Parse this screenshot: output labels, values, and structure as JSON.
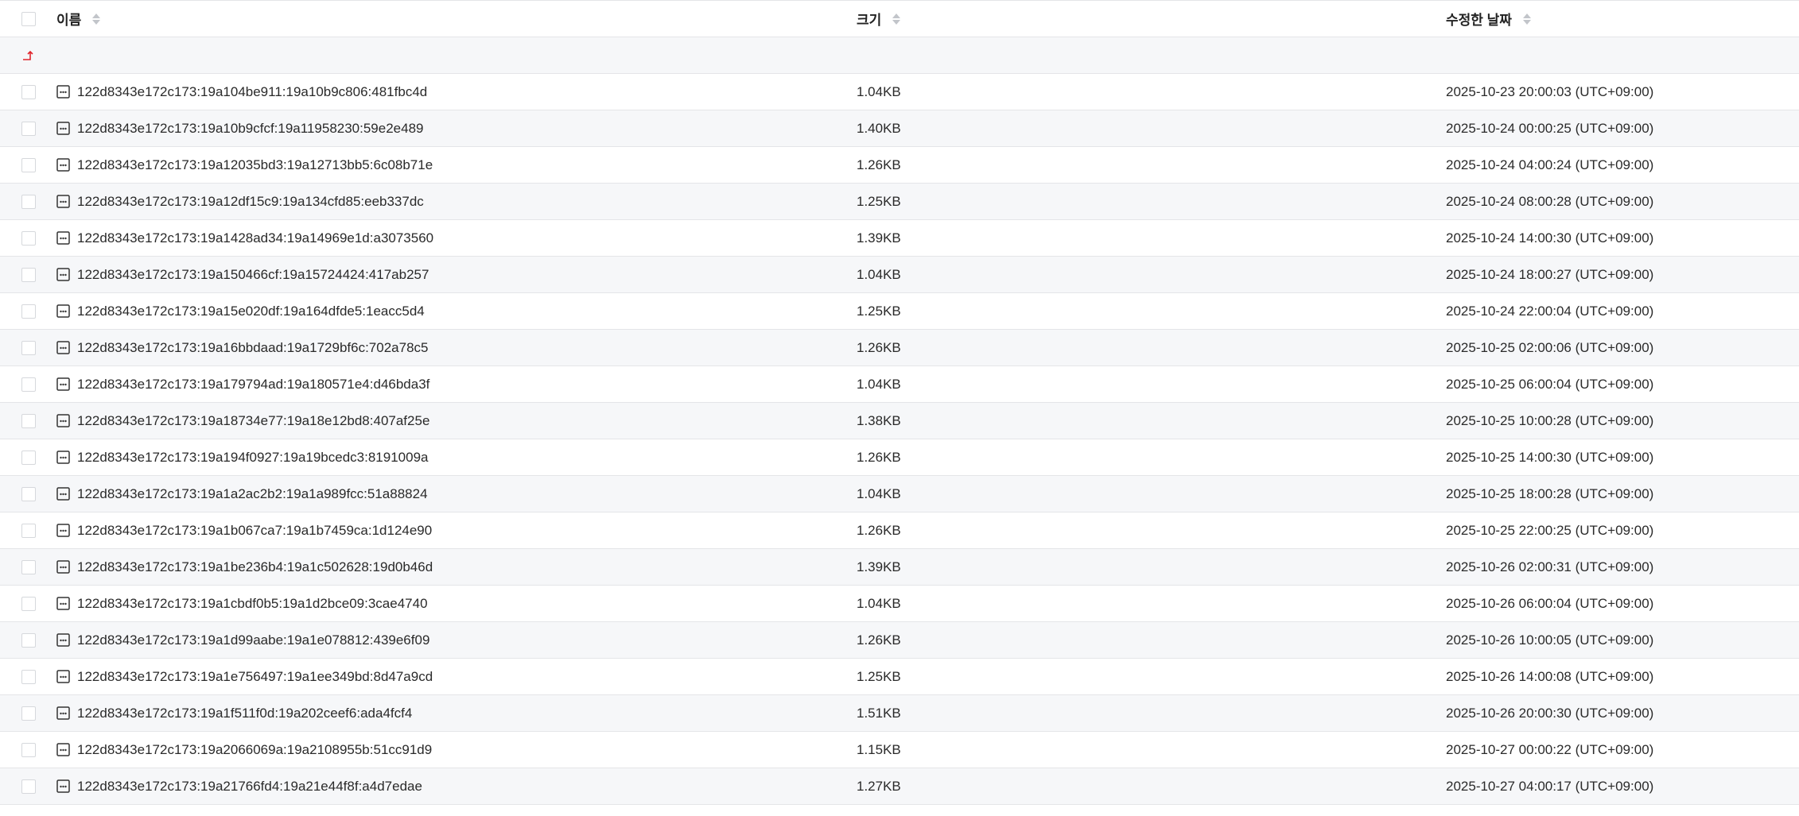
{
  "header": {
    "name": "이름",
    "size": "크기",
    "modified": "수정한 날짜"
  },
  "parent_row": {
    "icon": "up-arrow-icon",
    "accent": "#e0242b"
  },
  "files": [
    {
      "name": "122d8343e172c173:19a104be911:19a10b9c806:481fbc4d",
      "size": "1.04KB",
      "date": "2025-10-23 20:00:03 (UTC+09:00)"
    },
    {
      "name": "122d8343e172c173:19a10b9cfcf:19a11958230:59e2e489",
      "size": "1.40KB",
      "date": "2025-10-24 00:00:25 (UTC+09:00)"
    },
    {
      "name": "122d8343e172c173:19a12035bd3:19a12713bb5:6c08b71e",
      "size": "1.26KB",
      "date": "2025-10-24 04:00:24 (UTC+09:00)"
    },
    {
      "name": "122d8343e172c173:19a12df15c9:19a134cfd85:eeb337dc",
      "size": "1.25KB",
      "date": "2025-10-24 08:00:28 (UTC+09:00)"
    },
    {
      "name": "122d8343e172c173:19a1428ad34:19a14969e1d:a3073560",
      "size": "1.39KB",
      "date": "2025-10-24 14:00:30 (UTC+09:00)"
    },
    {
      "name": "122d8343e172c173:19a150466cf:19a15724424:417ab257",
      "size": "1.04KB",
      "date": "2025-10-24 18:00:27 (UTC+09:00)"
    },
    {
      "name": "122d8343e172c173:19a15e020df:19a164dfde5:1eacc5d4",
      "size": "1.25KB",
      "date": "2025-10-24 22:00:04 (UTC+09:00)"
    },
    {
      "name": "122d8343e172c173:19a16bbdaad:19a1729bf6c:702a78c5",
      "size": "1.26KB",
      "date": "2025-10-25 02:00:06 (UTC+09:00)"
    },
    {
      "name": "122d8343e172c173:19a179794ad:19a180571e4:d46bda3f",
      "size": "1.04KB",
      "date": "2025-10-25 06:00:04 (UTC+09:00)"
    },
    {
      "name": "122d8343e172c173:19a18734e77:19a18e12bd8:407af25e",
      "size": "1.38KB",
      "date": "2025-10-25 10:00:28 (UTC+09:00)"
    },
    {
      "name": "122d8343e172c173:19a194f0927:19a19bcedc3:8191009a",
      "size": "1.26KB",
      "date": "2025-10-25 14:00:30 (UTC+09:00)"
    },
    {
      "name": "122d8343e172c173:19a1a2ac2b2:19a1a989fcc:51a88824",
      "size": "1.04KB",
      "date": "2025-10-25 18:00:28 (UTC+09:00)"
    },
    {
      "name": "122d8343e172c173:19a1b067ca7:19a1b7459ca:1d124e90",
      "size": "1.26KB",
      "date": "2025-10-25 22:00:25 (UTC+09:00)"
    },
    {
      "name": "122d8343e172c173:19a1be236b4:19a1c502628:19d0b46d",
      "size": "1.39KB",
      "date": "2025-10-26 02:00:31 (UTC+09:00)"
    },
    {
      "name": "122d8343e172c173:19a1cbdf0b5:19a1d2bce09:3cae4740",
      "size": "1.04KB",
      "date": "2025-10-26 06:00:04 (UTC+09:00)"
    },
    {
      "name": "122d8343e172c173:19a1d99aabe:19a1e078812:439e6f09",
      "size": "1.26KB",
      "date": "2025-10-26 10:00:05 (UTC+09:00)"
    },
    {
      "name": "122d8343e172c173:19a1e756497:19a1ee349bd:8d47a9cd",
      "size": "1.25KB",
      "date": "2025-10-26 14:00:08 (UTC+09:00)"
    },
    {
      "name": "122d8343e172c173:19a1f511f0d:19a202ceef6:ada4fcf4",
      "size": "1.51KB",
      "date": "2025-10-26 20:00:30 (UTC+09:00)"
    },
    {
      "name": "122d8343e172c173:19a2066069a:19a2108955b:51cc91d9",
      "size": "1.15KB",
      "date": "2025-10-27 00:00:22 (UTC+09:00)"
    },
    {
      "name": "122d8343e172c173:19a21766fd4:19a21e44f8f:a4d7edae",
      "size": "1.27KB",
      "date": "2025-10-27 04:00:17 (UTC+09:00)"
    }
  ]
}
